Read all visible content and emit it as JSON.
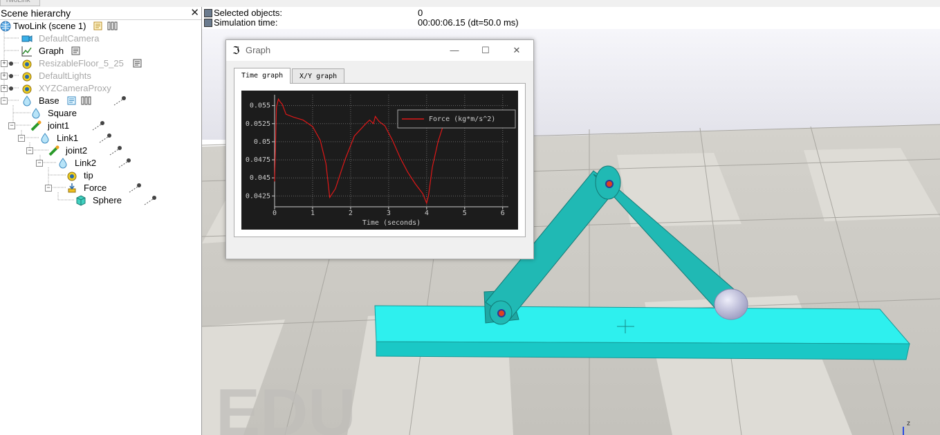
{
  "app": {
    "top_tab_label": "TwoLink"
  },
  "hierarchy": {
    "title": "Scene hierarchy",
    "close_glyph": "✕",
    "items": [
      {
        "label": "TwoLink (scene 1)",
        "icon": "scene-globe-icon",
        "dim": false
      },
      {
        "label": "DefaultCamera",
        "icon": "camera-icon",
        "dim": true
      },
      {
        "label": "Graph",
        "icon": "graph-icon",
        "dim": false
      },
      {
        "label": "ResizableFloor_5_25",
        "icon": "shape-icon",
        "dim": true
      },
      {
        "label": "DefaultLights",
        "icon": "light-icon",
        "dim": true
      },
      {
        "label": "XYZCameraProxy",
        "icon": "proxy-icon",
        "dim": true
      },
      {
        "label": "Base",
        "icon": "shape-icon",
        "dim": false
      },
      {
        "label": "Square",
        "icon": "shape-icon",
        "dim": false
      },
      {
        "label": "joint1",
        "icon": "joint-icon",
        "dim": false
      },
      {
        "label": "Link1",
        "icon": "shape-icon",
        "dim": false
      },
      {
        "label": "joint2",
        "icon": "joint-icon",
        "dim": false
      },
      {
        "label": "Link2",
        "icon": "shape-icon",
        "dim": false
      },
      {
        "label": "tip",
        "icon": "dummy-icon",
        "dim": false
      },
      {
        "label": "Force",
        "icon": "force-sensor-icon",
        "dim": false
      },
      {
        "label": "Sphere",
        "icon": "cube-shape-icon",
        "dim": false
      }
    ]
  },
  "info": {
    "selected_label": "Selected objects:",
    "selected_value": "0",
    "simtime_label": "Simulation time:",
    "simtime_value": "00:00:06.15 (dt=50.0 ms)"
  },
  "graph_window": {
    "title": "Graph",
    "tabs": [
      {
        "label": "Time graph",
        "active": true
      },
      {
        "label": "X/Y graph",
        "active": false
      }
    ]
  },
  "viewport": {
    "watermark": "EDU",
    "axis_label": "z"
  },
  "colors": {
    "link": "#20b9b4",
    "base": "#2ef0ee",
    "joint_dot": "#e04020",
    "sphere": "#c8c8e8",
    "plot_line": "#e01818",
    "plot_bg": "#1c1c1c"
  },
  "chart_data": {
    "type": "line",
    "xlabel": "Time (seconds)",
    "ylabel": "",
    "xlim": [
      0,
      6.15
    ],
    "ylim": [
      0.041,
      0.0565
    ],
    "xticks": [
      "0",
      "1",
      "2",
      "3",
      "4",
      "5",
      "6"
    ],
    "yticks": [
      "0.055",
      "0.0525",
      "0.05",
      "0.0475",
      "0.045",
      "0.0425"
    ],
    "grid": true,
    "legend_position": "top-right",
    "series": [
      {
        "name": "Force (kg*m/s^2)",
        "x": [
          0.0,
          0.05,
          0.1,
          0.15,
          0.2,
          0.3,
          0.5,
          0.75,
          1.0,
          1.2,
          1.35,
          1.45,
          1.6,
          1.85,
          2.1,
          2.4,
          2.5,
          2.6,
          2.65,
          2.75,
          2.9,
          3.1,
          3.3,
          3.5,
          3.7,
          3.9,
          4.0,
          4.05,
          4.15,
          4.3,
          4.45,
          4.6
        ],
        "values": [
          0.0445,
          0.0548,
          0.0559,
          0.0555,
          0.0552,
          0.0538,
          0.0534,
          0.053,
          0.0521,
          0.0502,
          0.047,
          0.0423,
          0.0435,
          0.0475,
          0.0508,
          0.0525,
          0.053,
          0.0525,
          0.0535,
          0.0528,
          0.0522,
          0.0502,
          0.0478,
          0.0458,
          0.0442,
          0.0428,
          0.0415,
          0.0426,
          0.0465,
          0.05,
          0.0525,
          0.0532
        ]
      }
    ],
    "tail_segment": {
      "x": [
        5.55,
        5.6,
        5.7,
        5.8,
        5.9,
        6.0,
        6.15
      ],
      "values": [
        0.0523,
        0.053,
        0.0527,
        0.0524,
        0.0525,
        0.0526,
        0.0527
      ]
    }
  }
}
